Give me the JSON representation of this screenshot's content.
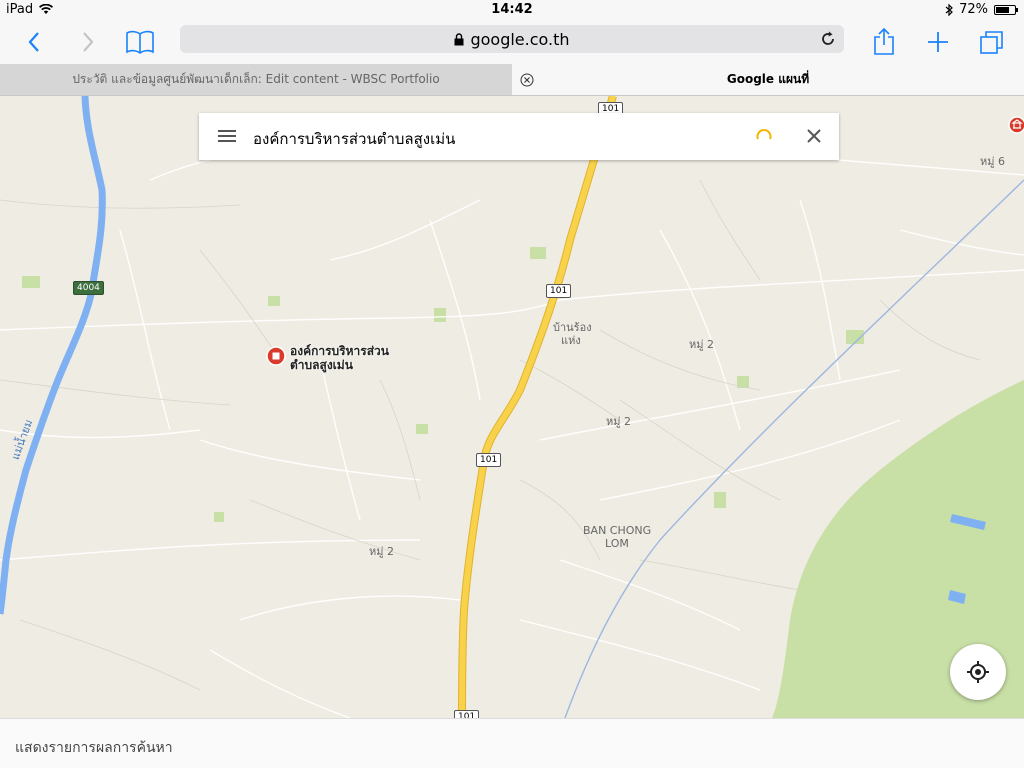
{
  "status": {
    "device": "iPad",
    "time": "14:42",
    "battery": "72%",
    "battery_fraction": 0.72
  },
  "browser": {
    "url": "google.co.th",
    "tabs": [
      {
        "label": "ประวัติ และข้อมูลศูนย์พัฒนาเด็กเล็ก: Edit content - WBSC Portfolio"
      },
      {
        "label": "Google แผนที่"
      }
    ]
  },
  "search": {
    "query": "องค์การบริหารส่วนตำบลสูงเม่น"
  },
  "map": {
    "poi": {
      "line1": "องค์การบริหารส่วน",
      "line2": "ตำบลสูงเม่น"
    },
    "labels": {
      "river": "แม่น้ำยม",
      "village_1": "บ้านร้อง",
      "village_1b": "แห่ง",
      "moo2_a": "หมู่ 2",
      "moo2_b": "หมู่ 2",
      "moo2_c": "หมู่ 2",
      "moo6": "หมู่ 6",
      "ban_chong": "BAN CHONG",
      "lom": "LOM"
    },
    "shields": {
      "route_4004": "4004",
      "route_101_a": "101",
      "route_101_b": "101",
      "route_101_c": "101",
      "route_101_d": "101"
    }
  },
  "bottom": {
    "label": "แสดงรายการผลการค้นหา"
  },
  "colors": {
    "accent": "#1a82fb",
    "map_bg": "#efece3",
    "highway": "#f8d24a",
    "river": "#7fb0f2",
    "park": "#c8dfa6",
    "poi": "#d93a2b"
  }
}
